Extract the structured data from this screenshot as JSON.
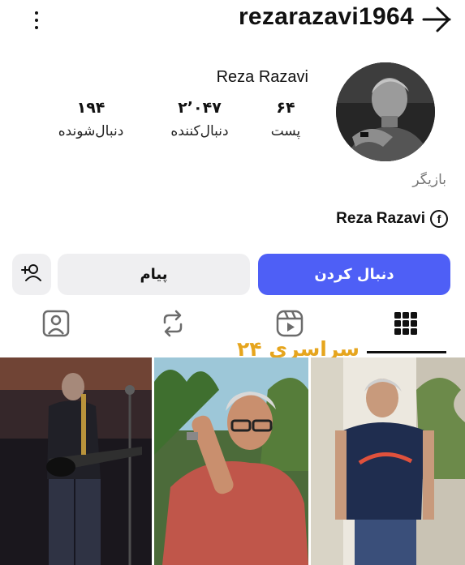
{
  "header": {
    "username": "rezarazavi1964",
    "menu_icon": "more-vertical-icon",
    "back_icon": "arrow-right-icon"
  },
  "profile": {
    "display_name": "Reza Razavi",
    "category": "بازیگر",
    "link_text": "Reza Razavi",
    "link_icon": "facebook-icon",
    "stats": {
      "posts": {
        "value": "۶۴",
        "label": "پست"
      },
      "followers": {
        "value": "۲٬۰۴۷",
        "label": "دنبال‌کننده"
      },
      "following": {
        "value": "۱۹۴",
        "label": "دنبال‌شونده"
      }
    }
  },
  "actions": {
    "follow_label": "دنبال کردن",
    "message_label": "پیام",
    "suggest_icon": "add-person-icon"
  },
  "tabs": [
    {
      "name": "grid",
      "icon": "grid-icon",
      "active": true
    },
    {
      "name": "reels",
      "icon": "reels-icon"
    },
    {
      "name": "reposts",
      "icon": "repost-icon"
    },
    {
      "name": "tagged",
      "icon": "tagged-icon"
    }
  ],
  "watermark": "سراسری ۲۴",
  "colors": {
    "accent": "#4e5ff6",
    "button_bg": "#efeff1",
    "watermark": "#e6a51d"
  }
}
